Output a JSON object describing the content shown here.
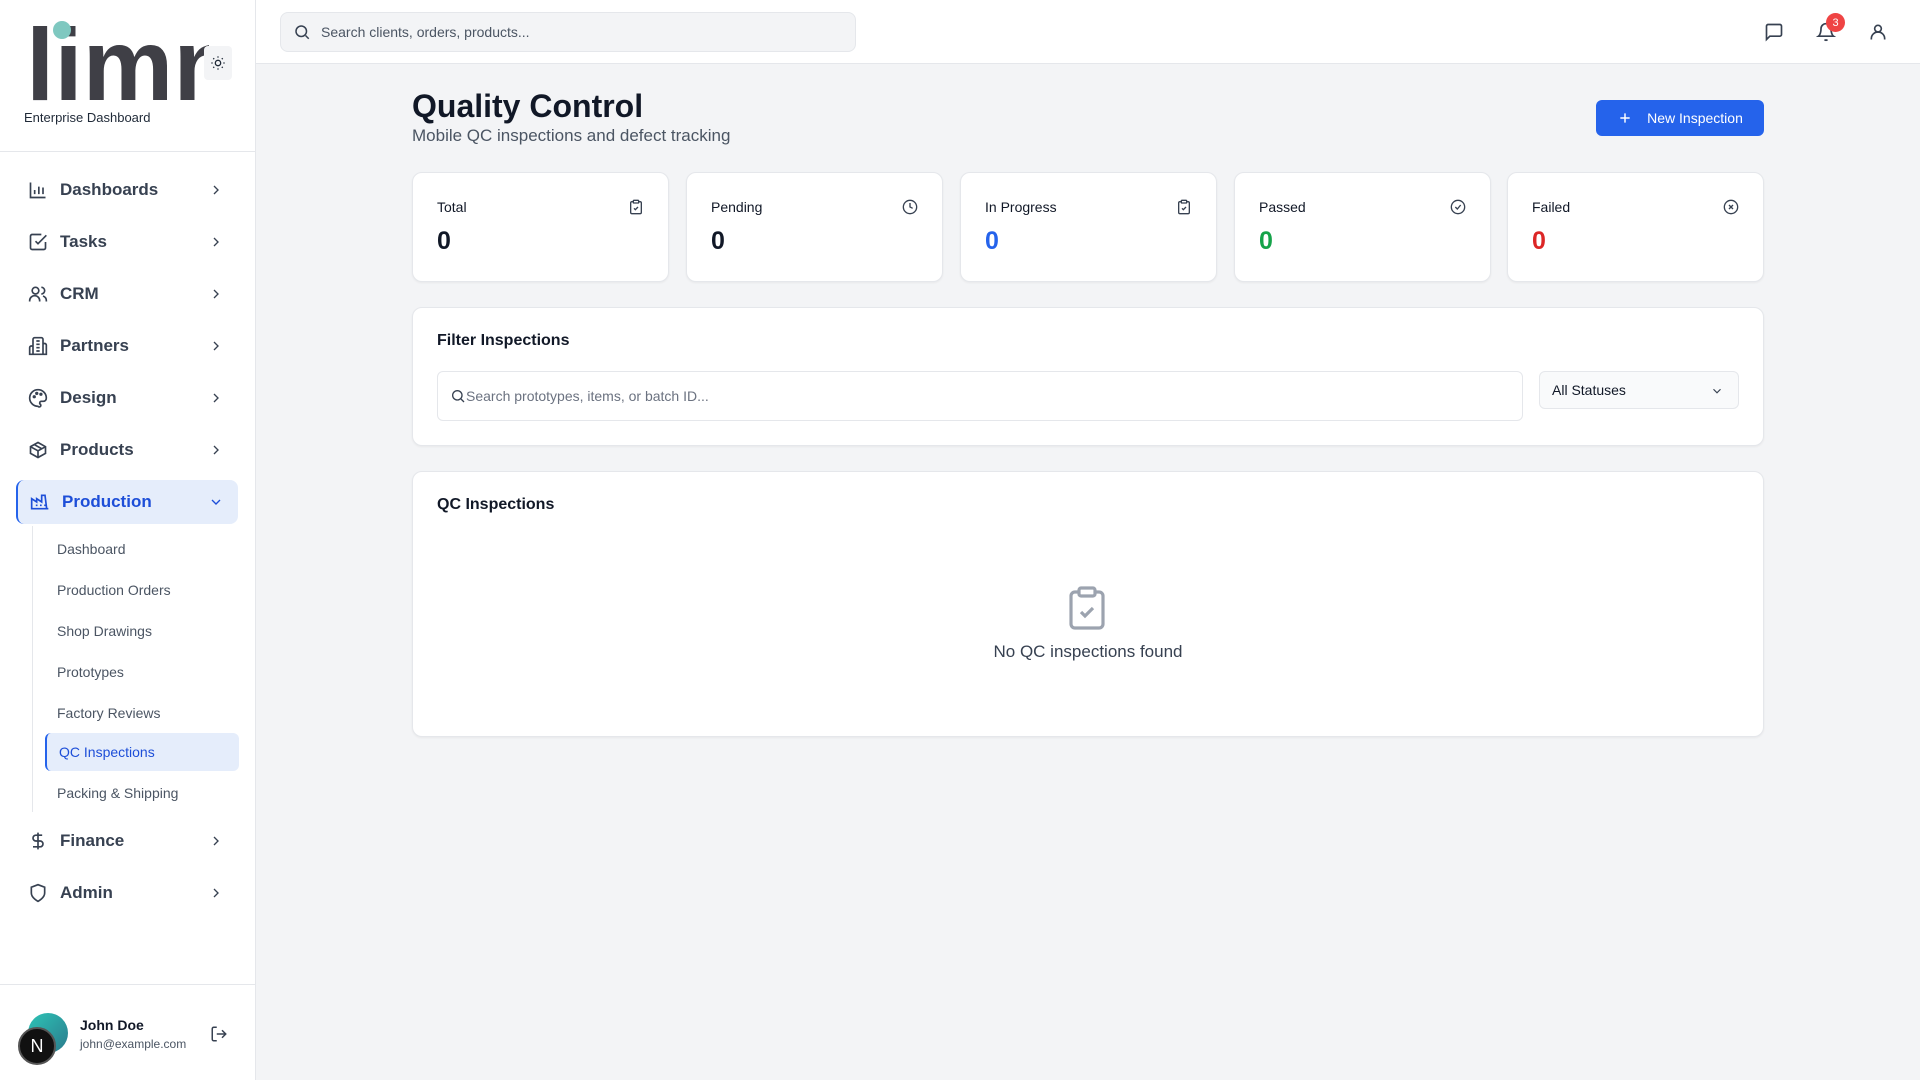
{
  "app": {
    "logo_text": "limn",
    "subtitle": "Enterprise Dashboard"
  },
  "sidebar": {
    "items": [
      {
        "label": "Dashboards",
        "icon": "bar-chart-icon"
      },
      {
        "label": "Tasks",
        "icon": "check-square-icon"
      },
      {
        "label": "CRM",
        "icon": "users-icon"
      },
      {
        "label": "Partners",
        "icon": "building-icon"
      },
      {
        "label": "Design",
        "icon": "palette-icon"
      },
      {
        "label": "Products",
        "icon": "package-icon"
      },
      {
        "label": "Production",
        "icon": "factory-icon",
        "expanded": true
      },
      {
        "label": "Finance",
        "icon": "dollar-icon"
      },
      {
        "label": "Admin",
        "icon": "shield-icon"
      }
    ],
    "production_sub": [
      "Dashboard",
      "Production Orders",
      "Shop Drawings",
      "Prototypes",
      "Factory Reviews",
      "QC Inspections",
      "Packing & Shipping"
    ],
    "active_sub": "QC Inspections"
  },
  "user": {
    "name": "John Doe",
    "email": "john@example.com",
    "badge_letter": "N"
  },
  "topbar": {
    "search_placeholder": "Search clients, orders, products...",
    "notification_count": "3"
  },
  "page": {
    "title": "Quality Control",
    "subtitle": "Mobile QC inspections and defect tracking",
    "new_button": "New Inspection"
  },
  "stats": [
    {
      "label": "Total",
      "value": "0",
      "color": "#111827",
      "icon": "clipboard-check-icon"
    },
    {
      "label": "Pending",
      "value": "0",
      "color": "#111827",
      "icon": "clock-icon"
    },
    {
      "label": "In Progress",
      "value": "0",
      "color": "#2563eb",
      "icon": "clipboard-check-icon"
    },
    {
      "label": "Passed",
      "value": "0",
      "color": "#16a34a",
      "icon": "check-circle-icon"
    },
    {
      "label": "Failed",
      "value": "0",
      "color": "#dc2626",
      "icon": "x-circle-icon"
    }
  ],
  "filter": {
    "title": "Filter Inspections",
    "search_placeholder": "Search prototypes, items, or batch ID...",
    "status_selected": "All Statuses"
  },
  "inspections": {
    "title": "QC Inspections",
    "empty_text": "No QC inspections found"
  },
  "colors": {
    "primary": "#2563eb",
    "active_bg": "#e5edfb",
    "badge": "#ef4444"
  }
}
